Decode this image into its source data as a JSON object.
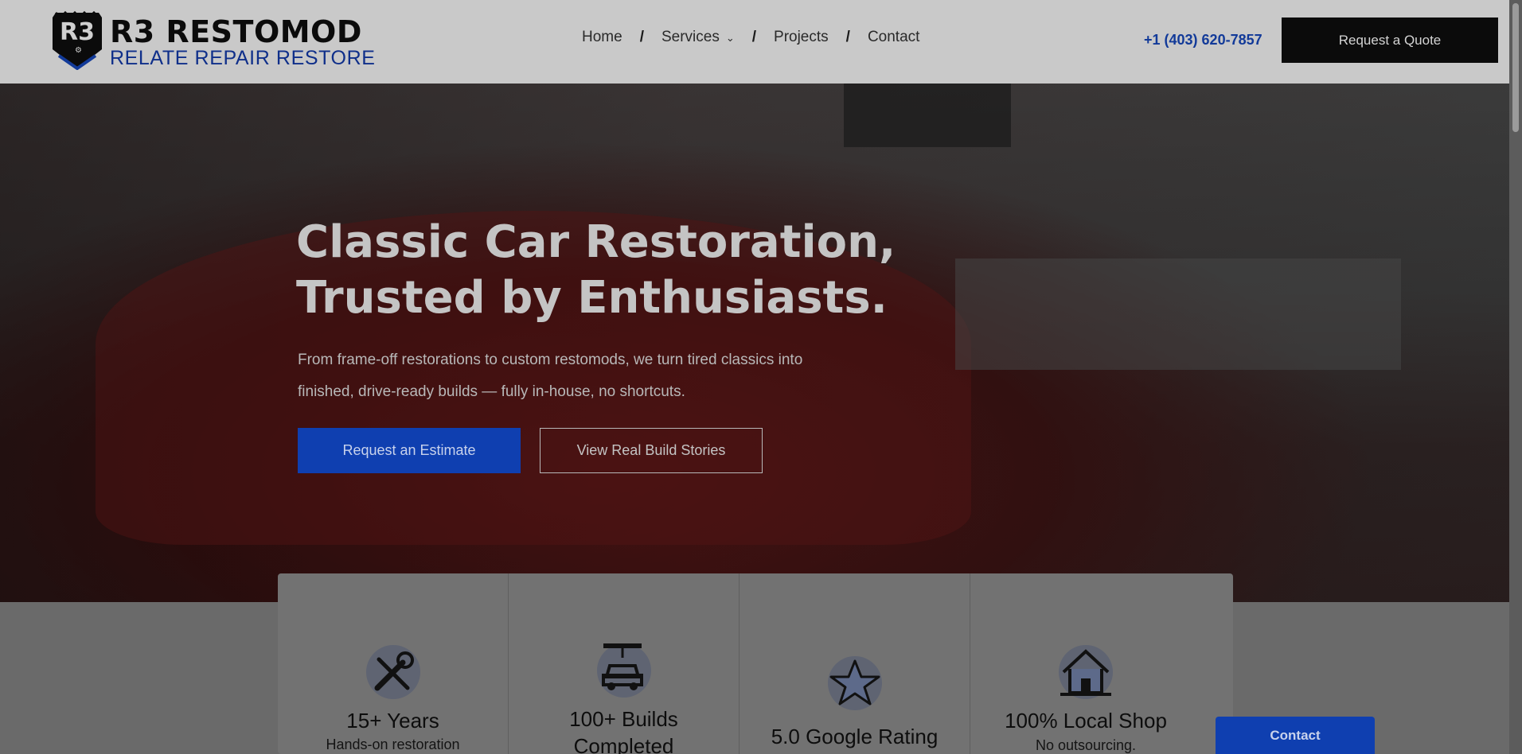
{
  "brand": {
    "title": "R3 RESTOMOD",
    "subtitle": "RELATE REPAIR RESTORE",
    "badge_text": "R3"
  },
  "nav": {
    "items": [
      {
        "label": "Home"
      },
      {
        "label": "Services"
      },
      {
        "label": "Projects"
      },
      {
        "label": "Contact"
      }
    ],
    "separator": "/"
  },
  "header": {
    "phone": "+1 (403) 620-7857",
    "quote_button": "Request a Quote"
  },
  "hero": {
    "title_line1": "Classic Car Restoration,",
    "title_line2": "Trusted by Enthusiasts.",
    "subtitle": "From frame-off restorations to custom restomods, we turn tired classics into finished, drive-ready builds — fully in-house, no shortcuts.",
    "primary_button": "Request an Estimate",
    "secondary_button": "View Real Build Stories"
  },
  "stats": [
    {
      "icon": "tools-icon",
      "title": "15+ Years",
      "subtitle": "Hands-on restoration"
    },
    {
      "icon": "car-lift-icon",
      "title": "100+ Builds Completed",
      "subtitle": ""
    },
    {
      "icon": "star-icon",
      "title": "5.0 Google Rating",
      "subtitle": ""
    },
    {
      "icon": "house-icon",
      "title": "100% Local Shop",
      "subtitle": "No outsourcing."
    }
  ],
  "floating": {
    "contact_button": "Contact"
  },
  "colors": {
    "accent": "#0f3fb0",
    "brand_blue": "#123a99",
    "header_bg": "#c9c9c9",
    "dark_button": "#0b0b0b"
  }
}
